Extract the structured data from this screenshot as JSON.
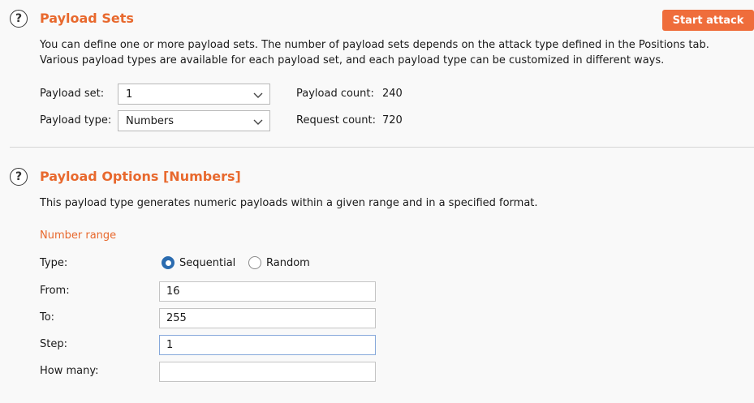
{
  "payload_sets": {
    "title": "Payload Sets",
    "description_line1": "You can define one or more payload sets. The number of payload sets depends on the attack type defined in the Positions tab.",
    "description_line2": "Various payload types are available for each payload set, and each payload type can be customized in different ways.",
    "start_attack_label": "Start attack",
    "payload_set_label": "Payload set:",
    "payload_set_value": "1",
    "payload_type_label": "Payload type:",
    "payload_type_value": "Numbers",
    "payload_count_label": "Payload count:",
    "payload_count_value": "240",
    "request_count_label": "Request count:",
    "request_count_value": "720"
  },
  "payload_options": {
    "title": "Payload Options [Numbers]",
    "description": "This payload type generates numeric payloads within a given range and in a specified format.",
    "number_range_heading": "Number range",
    "type_label": "Type:",
    "type_options": [
      "Sequential",
      "Random"
    ],
    "type_selected": "Sequential",
    "from_label": "From:",
    "from_value": "16",
    "to_label": "To:",
    "to_value": "255",
    "step_label": "Step:",
    "step_value": "1",
    "how_many_label": "How many:",
    "how_many_value": ""
  },
  "colors": {
    "accent_orange": "#e8692e",
    "button_orange": "#ef6d3b",
    "radio_selected_blue": "#2b6cb0",
    "focus_border": "#86a8da"
  }
}
